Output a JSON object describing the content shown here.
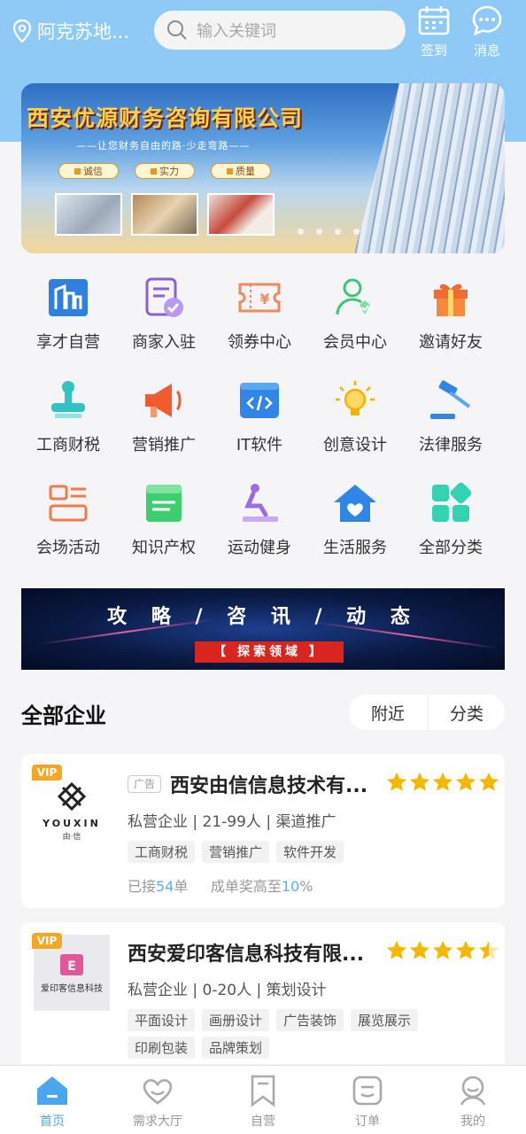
{
  "header": {
    "location": "阿克苏地...",
    "search_placeholder": "输入关键词",
    "checkin_label": "签到",
    "message_label": "消息"
  },
  "banner": {
    "title": "西安优源财务咨询有限公司",
    "subtitle": "——让您财务自由的路·少走弯路——",
    "pills": [
      "诚信",
      "实力",
      "质量"
    ]
  },
  "categories": [
    {
      "label": "享才自营",
      "icon": "building-icon"
    },
    {
      "label": "商家入驻",
      "icon": "form-check-icon"
    },
    {
      "label": "领券中心",
      "icon": "coupon-icon"
    },
    {
      "label": "会员中心",
      "icon": "member-icon"
    },
    {
      "label": "邀请好友",
      "icon": "gift-icon"
    },
    {
      "label": "工商财税",
      "icon": "stamp-icon"
    },
    {
      "label": "营销推广",
      "icon": "megaphone-icon"
    },
    {
      "label": "IT软件",
      "icon": "code-icon"
    },
    {
      "label": "创意设计",
      "icon": "bulb-icon"
    },
    {
      "label": "法律服务",
      "icon": "gavel-icon"
    },
    {
      "label": "会场活动",
      "icon": "venue-icon"
    },
    {
      "label": "知识产权",
      "icon": "certificate-icon"
    },
    {
      "label": "运动健身",
      "icon": "fitness-icon"
    },
    {
      "label": "生活服务",
      "icon": "home-heart-icon"
    },
    {
      "label": "全部分类",
      "icon": "all-category-icon"
    }
  ],
  "promo": {
    "headline": "攻 略 / 咨 讯 / 动 态",
    "button": "【 探索领域 】"
  },
  "section": {
    "title": "全部企业",
    "filter_nearby": "附近",
    "filter_category": "分类"
  },
  "companies": [
    {
      "vip": "VIP",
      "ad": "广告",
      "logo_text": "YOUXIN",
      "logo_sub": "由·信",
      "name": "西安由信信息技术有...",
      "rating": 5,
      "meta": "私营企业 | 21-99人 | 渠道推广",
      "tags": [
        "工商财税",
        "营销推广",
        "软件开发"
      ],
      "orders_prefix": "已接",
      "orders": "54",
      "orders_suffix": "单",
      "reward_prefix": "成单奖高至",
      "reward": "10",
      "reward_suffix": "%"
    },
    {
      "vip": "VIP",
      "logo_text": "爱印客信息科技",
      "name": "西安爱印客信息科技有限...",
      "rating": 4.5,
      "meta": "私营企业 | 0-20人 | 策划设计",
      "tags": [
        "平面设计",
        "画册设计",
        "广告装饰",
        "展览展示",
        "印刷包装",
        "品牌策划"
      ]
    }
  ],
  "tabbar": [
    {
      "label": "首页",
      "icon": "home-icon",
      "active": true
    },
    {
      "label": "需求大厅",
      "icon": "heart-hall-icon",
      "active": false
    },
    {
      "label": "自营",
      "icon": "bookmark-icon",
      "active": false
    },
    {
      "label": "订单",
      "icon": "order-icon",
      "active": false
    },
    {
      "label": "我的",
      "icon": "profile-icon",
      "active": false
    }
  ],
  "colors": {
    "header_blue": "#8fcaf7",
    "accent_blue": "#4aa6f0",
    "star_gold": "#f5b800",
    "vip_orange": "#f5a623"
  }
}
